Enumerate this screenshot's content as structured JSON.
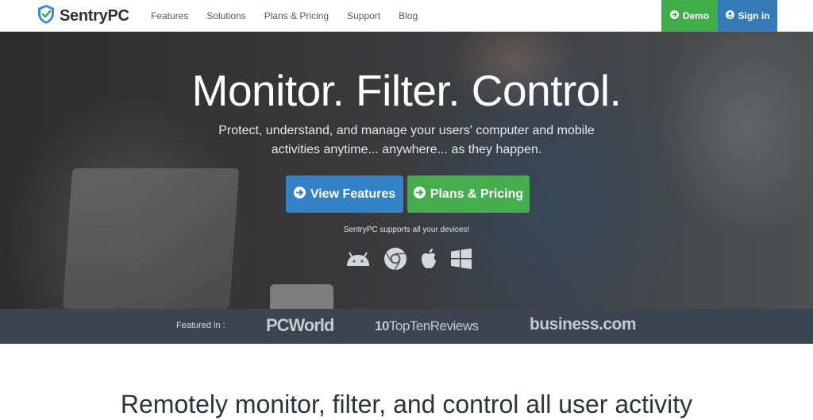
{
  "nav": {
    "logo_text": "SentryPC",
    "links": [
      "Features",
      "Solutions",
      "Plans & Pricing",
      "Support",
      "Blog"
    ],
    "demo_label": "Demo",
    "signin_label": "Sign in",
    "colors": {
      "demo": "#3fae49",
      "signin": "#337ab7"
    }
  },
  "hero": {
    "title": "Monitor. Filter. Control.",
    "subtitle": "Protect, understand, and manage your users' computer and mobile activities anytime... anywhere... as they happen.",
    "view_features_label": "View Features",
    "plans_pricing_label": "Plans & Pricing",
    "devices_note": "SentryPC supports all your devices!",
    "device_icons": [
      "android-icon",
      "chrome-icon",
      "apple-icon",
      "windows-icon"
    ]
  },
  "featured": {
    "label": "Featured in :",
    "publications": [
      "PCWorld",
      "TopTenReviews",
      "business.com"
    ]
  },
  "section": {
    "heading": "Remotely monitor, filter, and control all user activity"
  }
}
